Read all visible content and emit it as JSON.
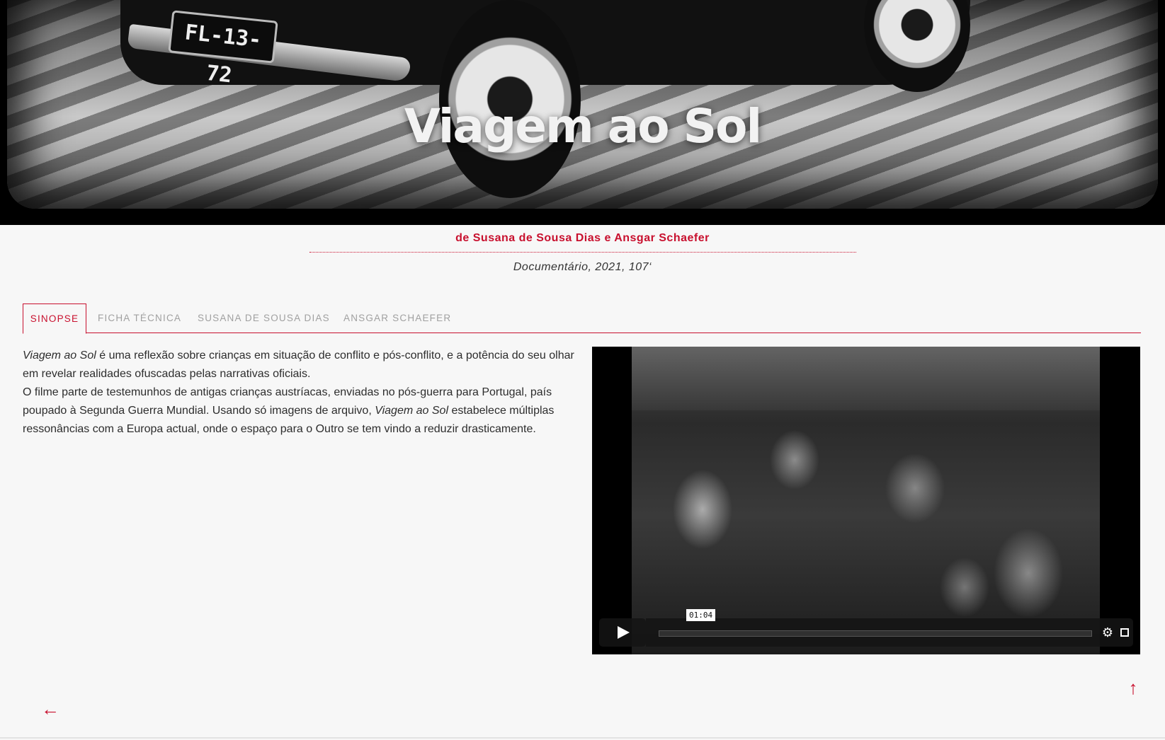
{
  "hero": {
    "title": "Viagem ao Sol",
    "plate_text": "FL-13-72"
  },
  "credits": {
    "authors": "de Susana de Sousa Dias e Ansgar Schaefer",
    "meta": "Documentário, 2021, 107‘"
  },
  "tabs": [
    {
      "label": "SINOPSE",
      "active": true
    },
    {
      "label": "FICHA TÉCNICA",
      "active": false
    },
    {
      "label": "SUSANA DE SOUSA DIAS",
      "active": false
    },
    {
      "label": "ANSGAR SCHAEFER",
      "active": false
    }
  ],
  "synopsis": {
    "p1_title": "Viagem ao Sol",
    "p1_text": " é uma reflexão sobre crianças em situação de conflito e pós-conflito, e a potência do seu olhar em revelar realidades ofuscadas pelas narrativas oficiais.",
    "p2_text_a": "O filme parte de testemunhos de antigas crianças austríacas, enviadas no pós-guerra para Portugal, país poupado à Segunda Guerra Mundial. Usando só imagens de arquivo, ",
    "p2_title": "Viagem ao Sol",
    "p2_text_b": " estabelece múltiplas ressonâncias com a Europa actual, onde o espaço para o Outro se tem vindo a reduzir drasticamente."
  },
  "video": {
    "time_tooltip": "01:04",
    "progress": 0,
    "icons": {
      "play": "play-icon",
      "settings": "gear-icon",
      "fullscreen": "fullscreen-icon"
    }
  },
  "nav": {
    "to_top_glyph": "↑",
    "back_glyph": "←"
  },
  "colors": {
    "accent": "#c8102e",
    "background": "#f7f7f7"
  }
}
